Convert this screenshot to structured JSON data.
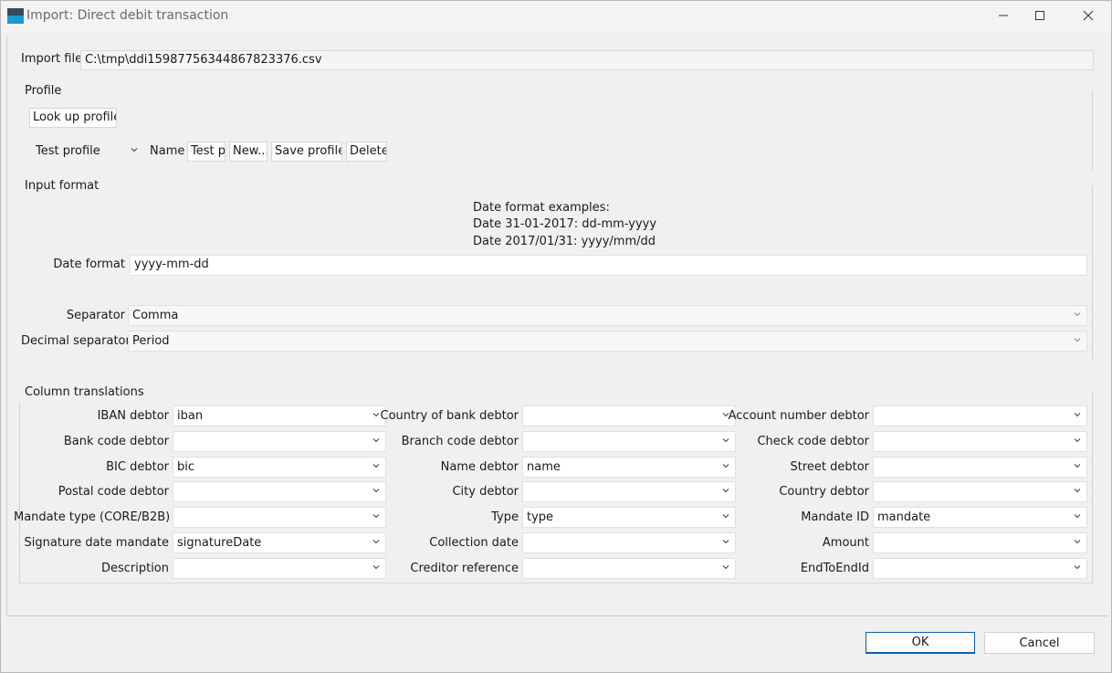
{
  "window": {
    "title": "Import: Direct debit transaction",
    "minimize_icon": "minimize-icon",
    "maximize_icon": "maximize-icon",
    "close_icon": "close-icon"
  },
  "import_file": {
    "label": "Import file",
    "value": "C:\\tmp\\ddi15987756344867823376.csv"
  },
  "profile": {
    "heading": "Profile",
    "lookup_label": "Look up profile",
    "selected": "Test profile",
    "name_label": "Name",
    "name_value": "Test profile",
    "new_label": "New...",
    "save_label": "Save profile",
    "delete_label": "Delete"
  },
  "input_format": {
    "heading": "Input format",
    "examples_title": "Date format examples:",
    "example1": "Date 31-01-2017: dd-mm-yyyy",
    "example2": "Date 2017/01/31: yyyy/mm/dd",
    "date_format_label": "Date format",
    "date_format_value": "yyyy-mm-dd",
    "separator_label": "Separator",
    "separator_value": "Comma",
    "decimal_label": "Decimal separator",
    "decimal_value": "Period"
  },
  "columns": {
    "heading": "Column translations",
    "rows": [
      [
        {
          "label": "IBAN debtor",
          "value": "iban"
        },
        {
          "label": "Country of bank debtor",
          "value": ""
        },
        {
          "label": "Account number debtor",
          "value": ""
        }
      ],
      [
        {
          "label": "Bank code debtor",
          "value": ""
        },
        {
          "label": "Branch code debtor",
          "value": ""
        },
        {
          "label": "Check code debtor",
          "value": ""
        }
      ],
      [
        {
          "label": "BIC debtor",
          "value": "bic"
        },
        {
          "label": "Name debtor",
          "value": "name"
        },
        {
          "label": "Street debtor",
          "value": ""
        }
      ],
      [
        {
          "label": "Postal code debtor",
          "value": ""
        },
        {
          "label": "City debtor",
          "value": ""
        },
        {
          "label": "Country debtor",
          "value": ""
        }
      ],
      [
        {
          "label": "Mandate type (CORE/B2B)",
          "value": ""
        },
        {
          "label": "Type",
          "value": "type"
        },
        {
          "label": "Mandate ID",
          "value": "mandate"
        }
      ],
      [
        {
          "label": "Signature date mandate",
          "value": "signatureDate"
        },
        {
          "label": "Collection date",
          "value": ""
        },
        {
          "label": "Amount",
          "value": ""
        }
      ],
      [
        {
          "label": "Description",
          "value": ""
        },
        {
          "label": "Creditor reference",
          "value": ""
        },
        {
          "label": "EndToEndId",
          "value": ""
        }
      ]
    ]
  },
  "footer": {
    "ok_label": "OK",
    "cancel_label": "Cancel"
  }
}
